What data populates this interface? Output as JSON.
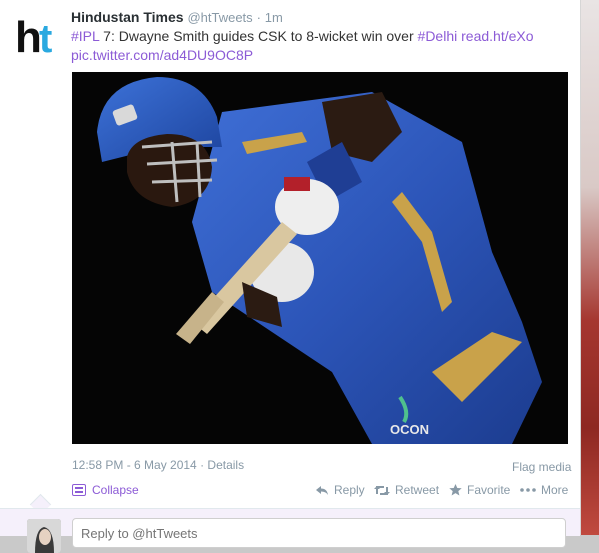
{
  "tweet": {
    "author_name": "Hindustan Times",
    "handle": "@htTweets",
    "separator": "·",
    "time_ago": "1m",
    "text_parts": {
      "hashtag_ipl": "#IPL",
      "text_main": " 7: Dwayne Smith guides CSK to 8-wicket win over ",
      "hashtag_delhi": "#Delhi",
      "link_url": " read.ht/eXo",
      "pic_link": "pic.twitter.com/ad4DU9OC8P"
    },
    "timestamp": "12:58 PM - 6 May 2014",
    "details_label": "Details",
    "meta_separator": "·",
    "flag_media": "Flag media"
  },
  "logo": {
    "text": "ht"
  },
  "actions": {
    "collapse": "Collapse",
    "reply": "Reply",
    "retweet": "Retweet",
    "favorite": "Favorite",
    "more": "More"
  },
  "reply": {
    "placeholder": "Reply to @htTweets"
  },
  "photo": {
    "jersey_text": "OCON"
  },
  "colors": {
    "link": "#8c5bd6",
    "muted": "#8899a6",
    "logo_blue": "#2aa9e0",
    "logo_dark": "#111111"
  }
}
